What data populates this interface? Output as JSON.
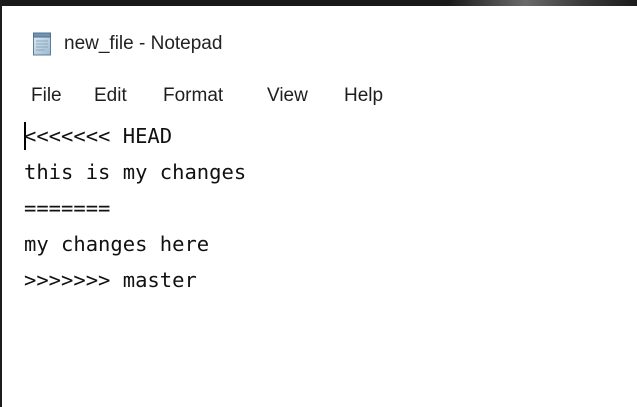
{
  "window": {
    "title": "new_file - Notepad",
    "icon": "notepad-icon"
  },
  "menu": {
    "items": [
      "File",
      "Edit",
      "Format",
      "View",
      "Help"
    ]
  },
  "editor": {
    "lines": [
      "<<<<<<< HEAD",
      "this is my changes",
      "=======",
      "my changes here",
      ">>>>>>> master"
    ]
  },
  "colors": {
    "background": "#ffffff",
    "text": "#111111",
    "frame": "#1a1a1a"
  }
}
